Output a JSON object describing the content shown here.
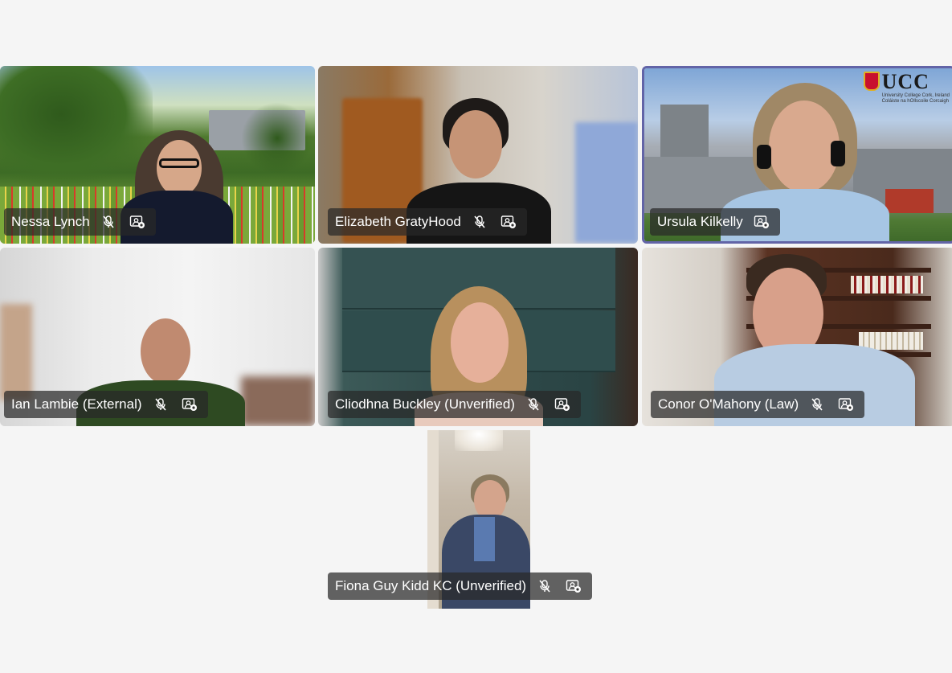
{
  "participants": [
    {
      "name": "Nessa Lynch",
      "muted": true
    },
    {
      "name": "Elizabeth GratyHood",
      "muted": true
    },
    {
      "name": "Ursula Kilkelly",
      "muted": false,
      "active_speaker": true
    },
    {
      "name": "Ian Lambie (External)",
      "muted": true
    },
    {
      "name": "Cliodhna Buckley (Unverified)",
      "muted": true
    },
    {
      "name": "Conor O'Mahony (Law)",
      "muted": true
    },
    {
      "name": "Fiona Guy Kidd KC (Unverified)",
      "muted": true
    }
  ],
  "background_logo": {
    "text": "UCC",
    "subtitle_en": "University College Cork, Ireland",
    "subtitle_ga": "Coláiste na hOllscoile Corcaigh"
  },
  "icons": {
    "mic_off": "mic-off-icon",
    "pin_video": "pin-video-icon"
  },
  "colors": {
    "active_border": "#6264a7",
    "stage_background": "#f5f5f5",
    "nameplate": "#282828"
  }
}
